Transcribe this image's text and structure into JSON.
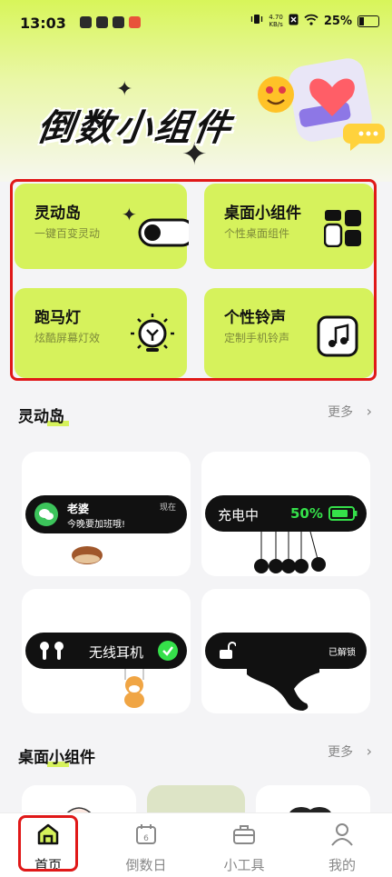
{
  "status_bar": {
    "time": "13:03",
    "net_speed_value": "4.70",
    "net_speed_unit": "KB/s",
    "battery": "25%"
  },
  "hero": {
    "title": "倒数小组件"
  },
  "feature_cards": [
    {
      "title": "灵动岛",
      "subtitle": "一键百变灵动"
    },
    {
      "title": "桌面小组件",
      "subtitle": "个性桌面组件"
    },
    {
      "title": "跑马灯",
      "subtitle": "炫酷屏幕灯效"
    },
    {
      "title": "个性铃声",
      "subtitle": "定制手机铃声"
    }
  ],
  "section_island": {
    "title": "灵动岛",
    "more": "更多"
  },
  "island_widgets": {
    "wechat": {
      "name": "老婆",
      "message": "今晚要加班哦!",
      "time": "现在"
    },
    "charging": {
      "label": "充电中",
      "percent": "50%"
    },
    "earphones": {
      "label": "无线耳机"
    },
    "unlock": {
      "label": "已解锁"
    }
  },
  "section_desktop": {
    "title": "桌面小组件",
    "more": "更多"
  },
  "bottom_nav": [
    {
      "label": "首页",
      "active": true
    },
    {
      "label": "倒数日",
      "active": false
    },
    {
      "label": "小工具",
      "active": false
    },
    {
      "label": "我的",
      "active": false
    }
  ],
  "colors": {
    "accent": "#d6f25c",
    "highlight_border": "#e01818",
    "charging_green": "#35e04a",
    "wechat_green": "#3cc45b"
  }
}
